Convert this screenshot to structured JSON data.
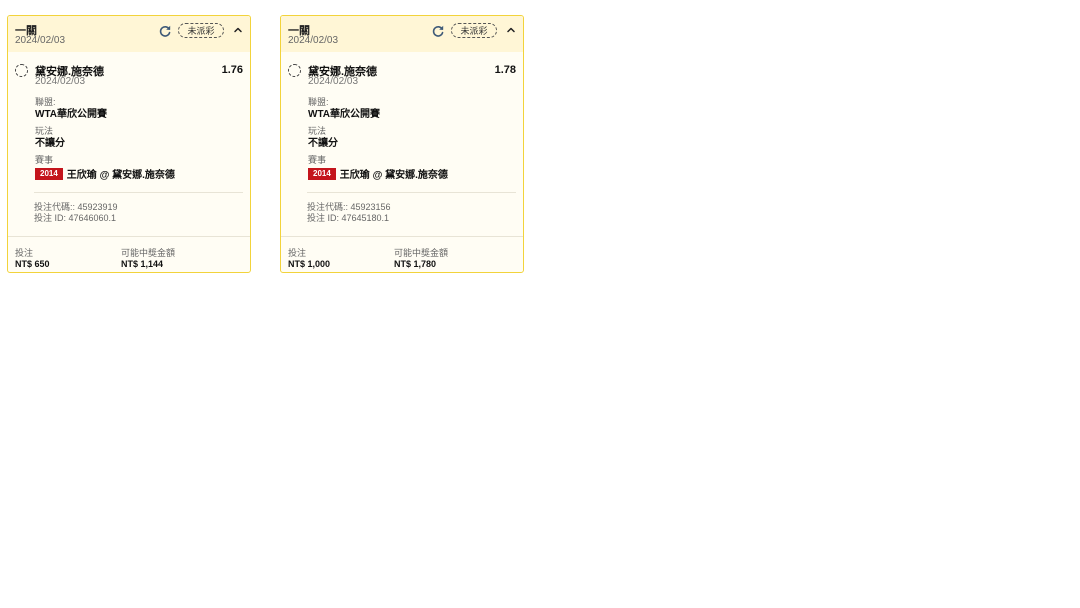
{
  "cards": [
    {
      "header_title": "一關",
      "header_date": "2024/02/03",
      "status": "未派彩",
      "refresh_icon": "refresh-icon",
      "collapse_icon": "chevron-up-icon",
      "selection_name": "黛安娜.施奈德",
      "selection_date": "2024/02/03",
      "odds": "1.76",
      "league_label": "聯盟:",
      "league_value": "WTA華欣公開賽",
      "bet_type_label": "玩法",
      "bet_type_value": "不讓分",
      "event_label": "賽事",
      "event_year": "2014",
      "event_value": "王欣瑜 @ 黛安娜.施奈德",
      "bet_code": "投注代碼:: 45923919",
      "bet_id": "投注 ID: 47646060.1",
      "stake_label": "投注",
      "stake_value": "NT$ 650",
      "payout_label": "可能中獎金額",
      "payout_value": "NT$ 1,144"
    },
    {
      "header_title": "一關",
      "header_date": "2024/02/03",
      "status": "未派彩",
      "refresh_icon": "refresh-icon",
      "collapse_icon": "chevron-up-icon",
      "selection_name": "黛安娜.施奈德",
      "selection_date": "2024/02/03",
      "odds": "1.78",
      "league_label": "聯盟:",
      "league_value": "WTA華欣公開賽",
      "bet_type_label": "玩法",
      "bet_type_value": "不讓分",
      "event_label": "賽事",
      "event_year": "2014",
      "event_value": "王欣瑜 @ 黛安娜.施奈德",
      "bet_code": "投注代碼:: 45923156",
      "bet_id": "投注 ID: 47645180.1",
      "stake_label": "投注",
      "stake_value": "NT$ 1,000",
      "payout_label": "可能中獎金額",
      "payout_value": "NT$ 1,780"
    }
  ],
  "colors": {
    "border": "#f2d33b",
    "header_bg": "#fff6d6",
    "card_bg": "#fffdf4",
    "year_badge": "#c4151c"
  }
}
